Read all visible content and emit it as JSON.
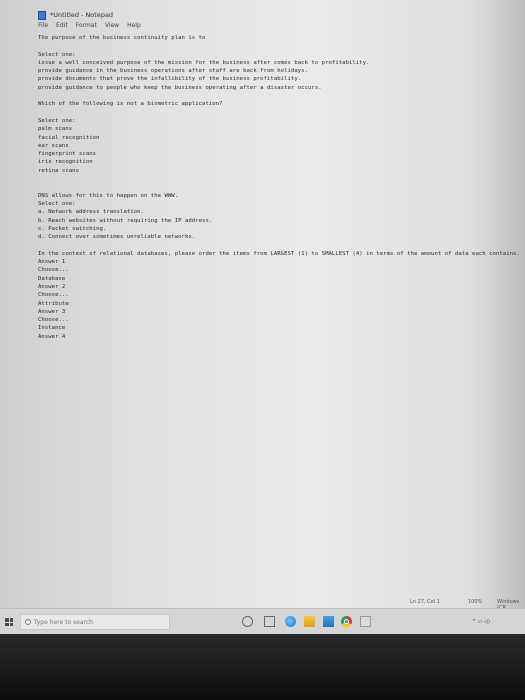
{
  "window": {
    "title": "*Untitled - Notepad"
  },
  "menu": [
    "File",
    "Edit",
    "Format",
    "View",
    "Help"
  ],
  "lines": [
    "The purpose of the business continuity plan is to",
    "",
    "Select one:",
    "issue a well conceived purpose of the mission for the business after comes back to profitability.",
    "provide guidance in the business operations after staff are back from holidays.",
    "provide documents that prove the infallibility of the business profitability.",
    "provide guidance to people who keep the business operating after a disaster occurs.",
    "",
    "Which of the following is not a biometric application?",
    "",
    "Select one:",
    "palm scans",
    "facial recognition",
    "ear scans",
    "fingerprint scans",
    "iris recognition",
    "retina scans",
    "",
    "",
    "DNS allows for this to happen on the WWW.",
    "Select one:",
    "a. Network address translation.",
    "b. Reach websites without requiring the IP address.",
    "c. Packet switching.",
    "d. Connect over sometimes unreliable networks.",
    "",
    "In the context of relational databases, please order the items from LARGEST (1) to SMALLEST (4) in terms of the amount of data each contains.",
    "Answer 1",
    "Choose...",
    "Database",
    "Answer 2",
    "Choose...",
    "Attribute",
    "Answer 3",
    "Choose...",
    "Instance",
    "Answer 4"
  ],
  "status": {
    "position": "Ln 27, Col 1",
    "zoom": "100%",
    "eol": "Windows (CR"
  },
  "taskbar": {
    "search_placeholder": "Type here to search"
  },
  "colors": {
    "taskbar_bg": "#d5d5d5",
    "text": "#2a2a2a",
    "notepad_icon": "#3a7bd5"
  },
  "icons": [
    "windows-start-icon",
    "search-icon",
    "cortana-icon",
    "task-view-icon",
    "edge-icon",
    "file-explorer-icon",
    "store-icon",
    "chrome-icon",
    "notepad-icon"
  ]
}
